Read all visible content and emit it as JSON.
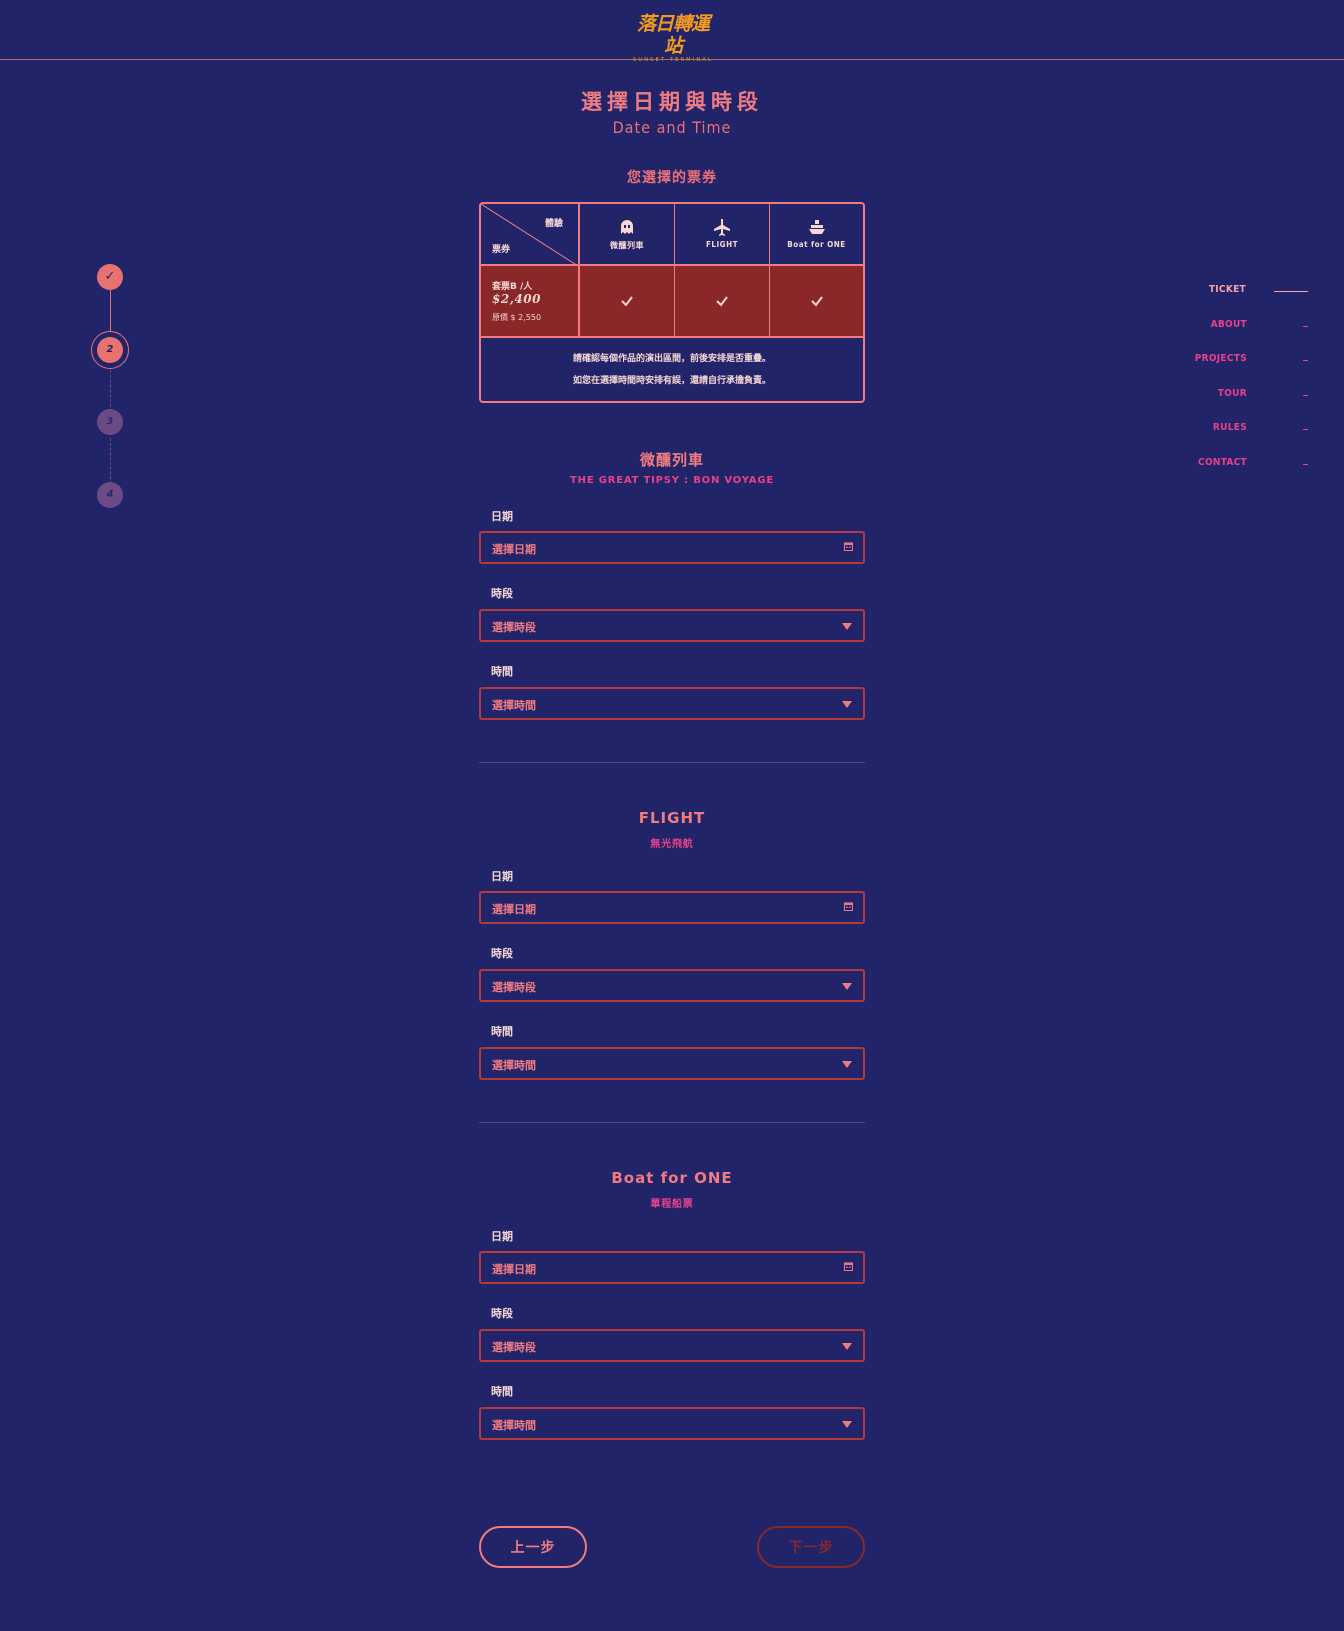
{
  "brand": {
    "logo_main": "落日轉運站",
    "logo_sub": "SUNSET TERMINAL"
  },
  "page": {
    "title": "選擇日期與時段",
    "subtitle": "Date and Time",
    "selected_heading": "您選擇的票券"
  },
  "stepper": {
    "steps": [
      "✓",
      "2",
      "3",
      "4"
    ],
    "current": 2
  },
  "nav": {
    "items": [
      "TICKET",
      "ABOUT",
      "PROJECTS",
      "TOUR",
      "RULES",
      "CONTACT"
    ],
    "active": "TICKET"
  },
  "ticket_table": {
    "corner_top": "體驗",
    "corner_bottom": "票券",
    "columns": [
      {
        "label": "微醺列車",
        "icon": "ghost-icon"
      },
      {
        "label": "FLIGHT",
        "icon": "plane-icon"
      },
      {
        "label": "Boat for ONE",
        "icon": "boat-icon"
      }
    ],
    "package": {
      "name": "套票B /人",
      "price": "$2,400",
      "original": "原價 $ 2,550"
    },
    "notes": [
      "請確認每個作品的演出區間，前後安排是否重疊。",
      "如您在選擇時間時安排有誤，還請自行承擔負責。"
    ]
  },
  "sections": [
    {
      "title": "微醺列車",
      "subtitle": "THE GREAT TIPSY : BON VOYAGE",
      "date_label": "日期",
      "date_placeholder": "選擇日期",
      "session_label": "時段",
      "session_placeholder": "選擇時段",
      "time_label": "時間",
      "time_placeholder": "選擇時間"
    },
    {
      "title": "FLIGHT",
      "subtitle": "無光飛航",
      "date_label": "日期",
      "date_placeholder": "選擇日期",
      "session_label": "時段",
      "session_placeholder": "選擇時段",
      "time_label": "時間",
      "time_placeholder": "選擇時間"
    },
    {
      "title": "Boat for ONE",
      "subtitle": "單程船票",
      "date_label": "日期",
      "date_placeholder": "選擇日期",
      "session_label": "時段",
      "session_placeholder": "選擇時段",
      "time_label": "時間",
      "time_placeholder": "選擇時間"
    }
  ],
  "buttons": {
    "prev": "上一步",
    "next": "下一步"
  },
  "colors": {
    "background": "#22246a",
    "accent": "#f07c82",
    "highlight_row": "#8a2728",
    "logo": "#f29a20",
    "nav_link": "#e9408a"
  }
}
